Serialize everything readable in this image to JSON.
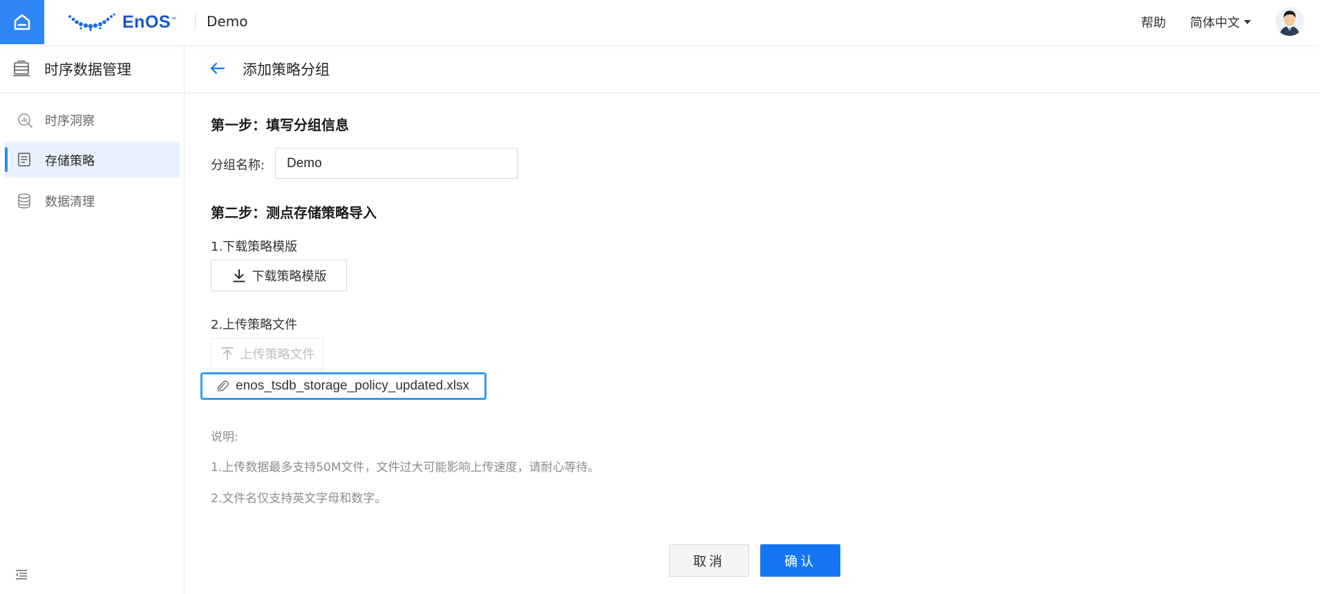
{
  "topbar": {
    "logo_text": "EnOS",
    "logo_tm": "™",
    "app_name": "Demo",
    "help": "帮助",
    "language": "简体中文"
  },
  "sidebar": {
    "title": "时序数据管理",
    "items": [
      {
        "label": "时序洞察",
        "icon": "chart-search-icon",
        "active": false
      },
      {
        "label": "存储策略",
        "icon": "storage-policy-icon",
        "active": true
      },
      {
        "label": "数据清理",
        "icon": "database-icon",
        "active": false
      }
    ]
  },
  "page": {
    "title": "添加策略分组",
    "step1": {
      "title": "第一步：填写分组信息",
      "name_label": "分组名称:",
      "name_value": "Demo"
    },
    "step2": {
      "title": "第二步：测点存储策略导入",
      "download_label": "1.下载策略模版",
      "download_button": "下载策略模版",
      "upload_label": "2.上传策略文件",
      "upload_button": "上传策略文件",
      "file_name": "enos_tsdb_storage_policy_updated.xlsx"
    },
    "notes": {
      "heading": "说明:",
      "line1": "1.上传数据最多支持50M文件，文件过大可能影响上传速度，请耐心等待。",
      "line2": "2.文件名仅支持英文字母和数字。"
    },
    "actions": {
      "cancel": "取消",
      "confirm": "确认"
    }
  },
  "colors": {
    "accent": "#1476f3",
    "home_button": "#2f86f6",
    "file_highlight": "#2d9cf2",
    "active_item_bg": "#e8f1fd"
  }
}
